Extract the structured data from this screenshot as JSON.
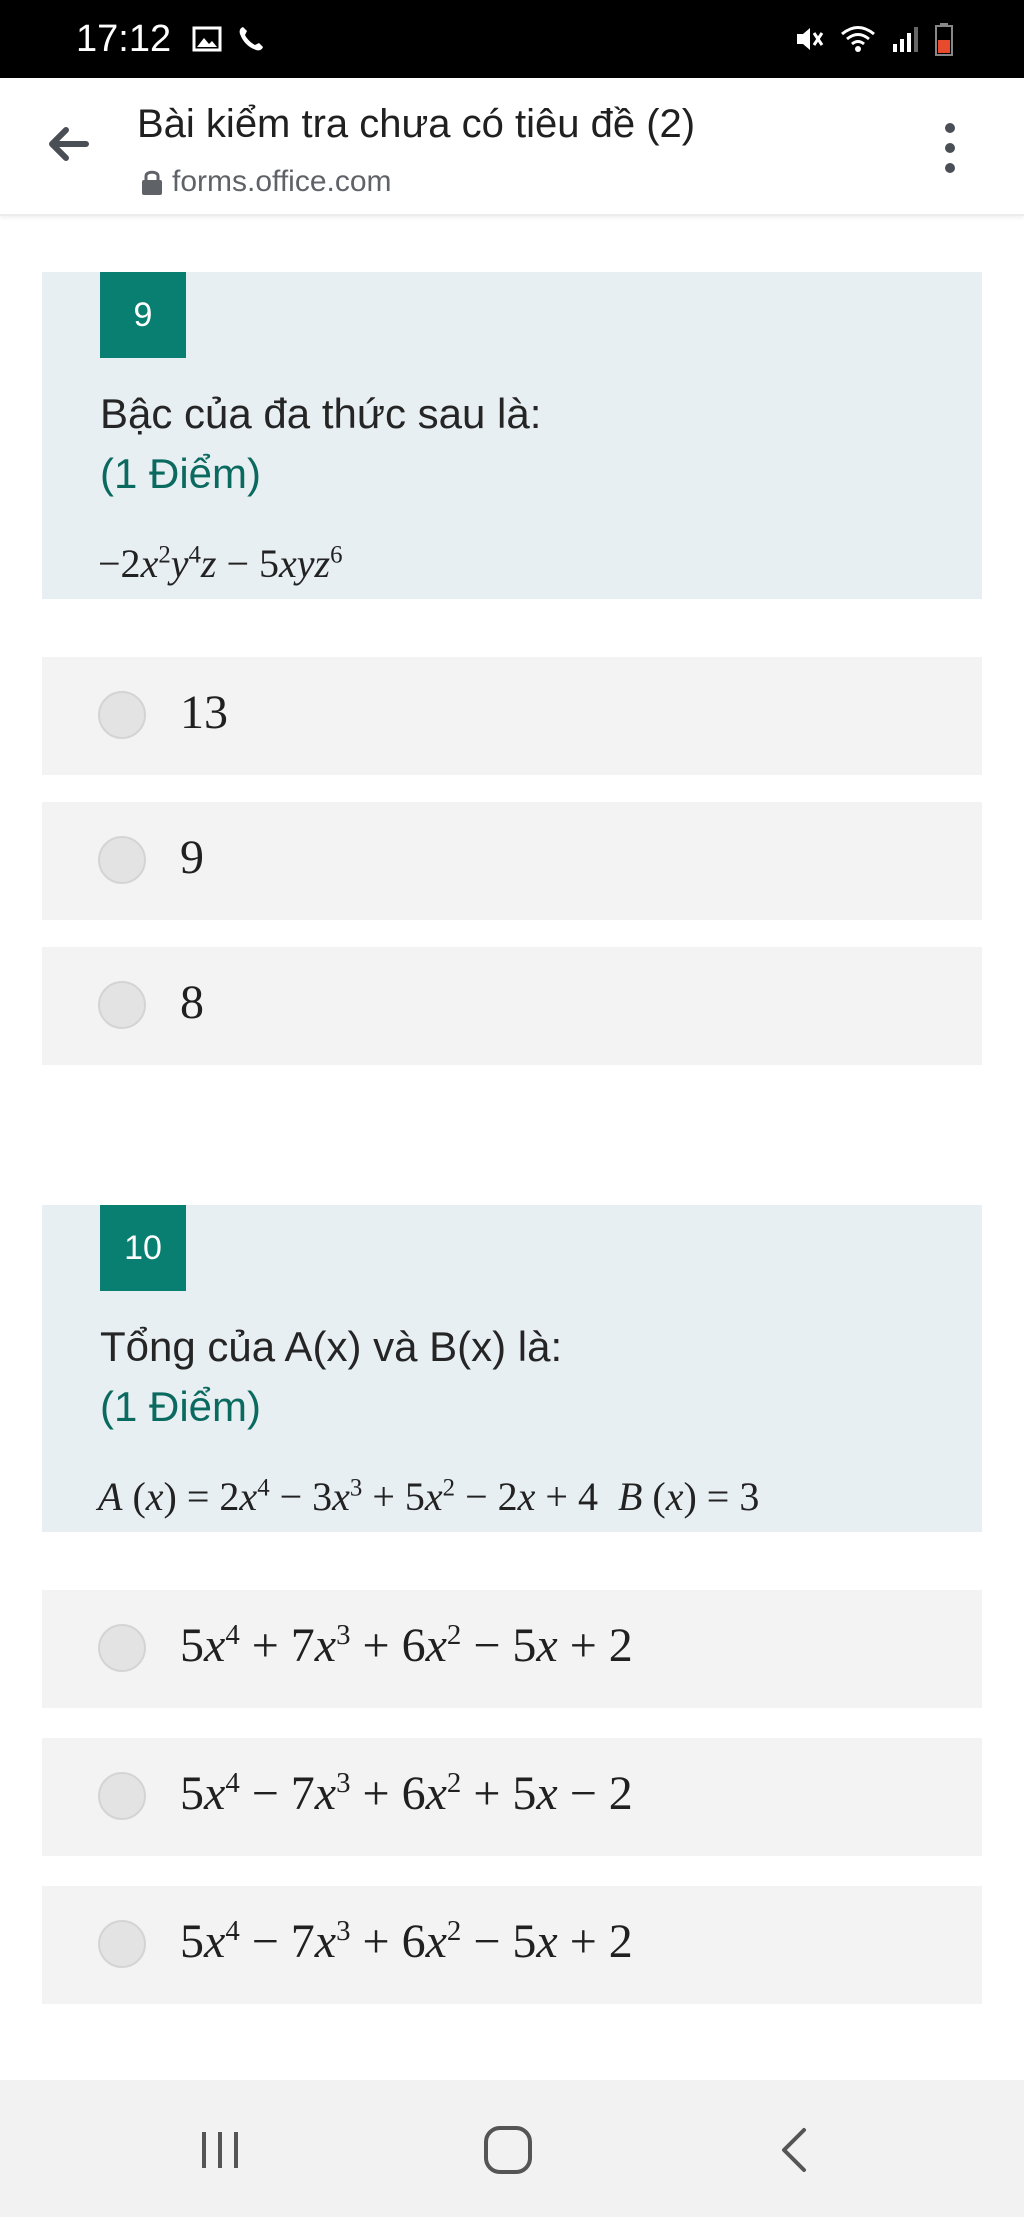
{
  "status_bar": {
    "time": "17:12",
    "icons_left": [
      "image-icon",
      "phone-icon"
    ],
    "icons_right": [
      "mute-icon",
      "wifi-icon",
      "signal-icon",
      "battery-icon"
    ],
    "colors": {
      "background": "#000000",
      "text": "#ffffff",
      "battery": "#e84a2e"
    }
  },
  "browser": {
    "title": "Bài kiểm tra chưa có tiêu đề (2)",
    "url": "forms.office.com",
    "icons": [
      "back-arrow-icon",
      "lock-icon",
      "more-vert-icon"
    ]
  },
  "questions": [
    {
      "number": "9",
      "title": "Bậc của đa thức sau là:",
      "points": "(1 Điểm)",
      "formula_text": "−2x²y⁴z − 5xyz⁶",
      "options": [
        "13",
        "9",
        "8"
      ]
    },
    {
      "number": "10",
      "title": "Tổng của A(x) và B(x) là:",
      "points": "(1 Điểm)",
      "formula_text": "A (x) = 2x⁴ − 3x³ + 5x² − 2x + 4  B (x) = 3",
      "options": [
        "5x⁴ + 7x³ + 6x² − 5x + 2",
        "5x⁴ − 7x³ + 6x² + 5x − 2",
        "5x⁴ − 7x³ + 6x² − 5x + 2"
      ]
    }
  ],
  "nav_bar": {
    "buttons": [
      "recent-apps-icon",
      "home-icon",
      "back-icon"
    ]
  },
  "colors": {
    "accent": "#087f70",
    "question_bg": "#e8eff3",
    "option_bg": "#f3f3f3",
    "points_text": "#0b6a60"
  }
}
